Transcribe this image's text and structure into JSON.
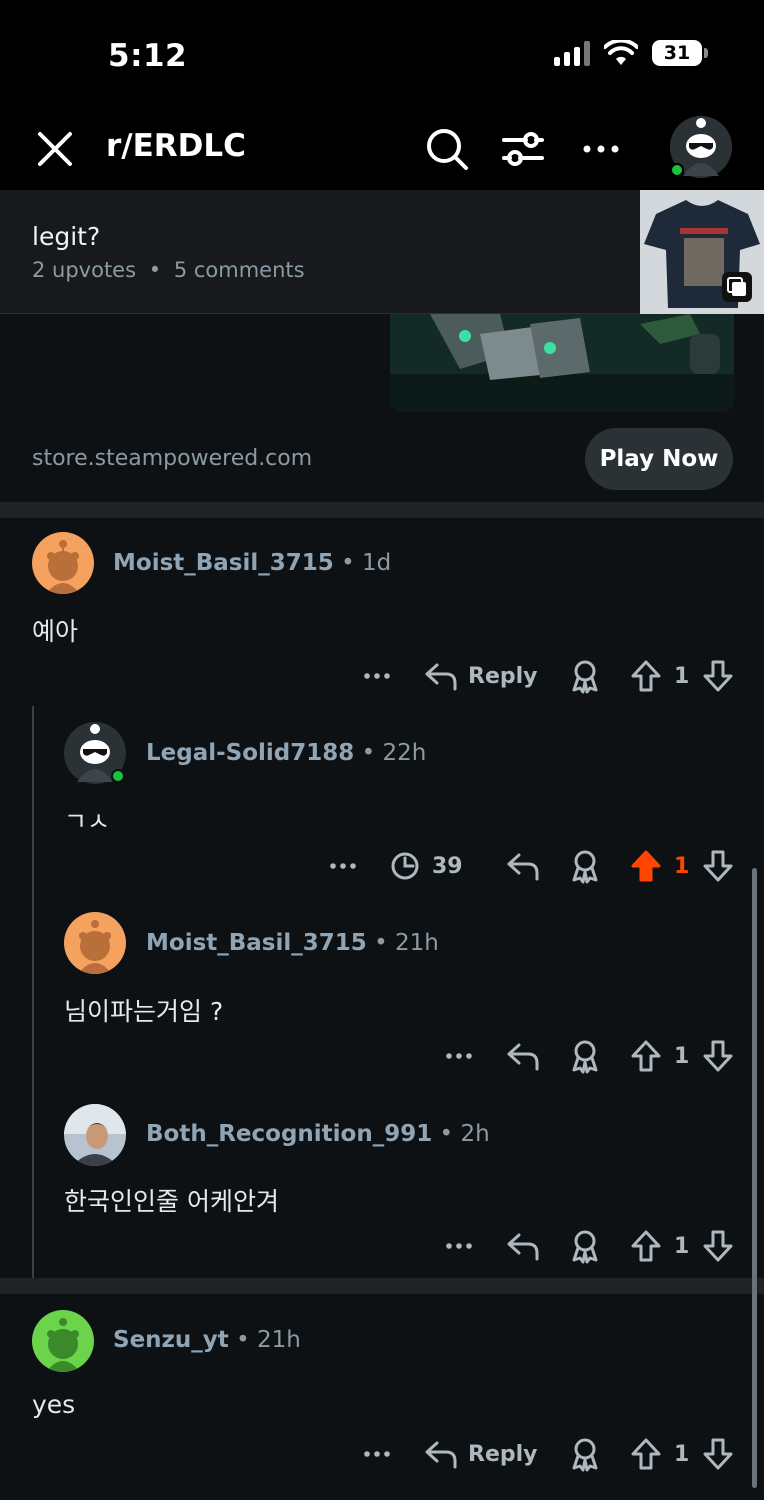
{
  "status_bar": {
    "time": "5:12",
    "battery": "31"
  },
  "header": {
    "subreddit": "r/ERDLC"
  },
  "post": {
    "title": "legit?",
    "upvotes": "2 upvotes",
    "separator": "•",
    "comments": "5 comments"
  },
  "ad": {
    "domain": "store.steampowered.com",
    "cta": "Play Now"
  },
  "colors": {
    "upvote_active": "#ff4500",
    "muted": "#8b9aa3",
    "username": "#8fa5b5",
    "online": "#19c33f"
  },
  "comments": [
    {
      "user": "Moist_Basil_3715",
      "time": "1d",
      "body": "예아",
      "votes": "1",
      "reply_label": "Reply"
    },
    {
      "user": "Legal-Solid7188",
      "time": "22h",
      "body": "ㄱㅅ",
      "votes": "1",
      "timer": "39"
    },
    {
      "user": "Moist_Basil_3715",
      "time": "21h",
      "body": "님이파는거임 ?",
      "votes": "1"
    },
    {
      "user": "Both_Recognition_991",
      "time": "2h",
      "body": "한국인인줄 어케안겨",
      "votes": "1"
    },
    {
      "user": "Senzu_yt",
      "time": "21h",
      "body": "yes",
      "votes": "1",
      "reply_label": "Reply"
    }
  ]
}
